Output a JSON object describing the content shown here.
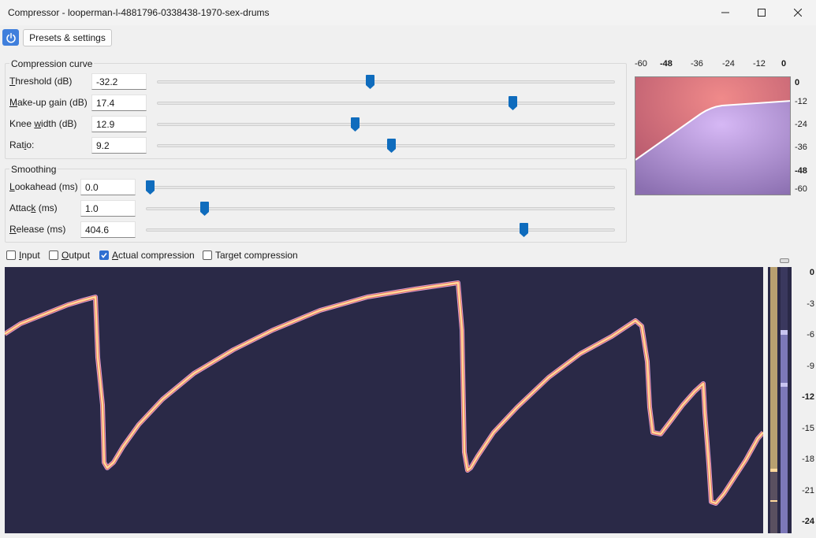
{
  "window": {
    "title": "Compressor - looperman-l-4881796-0338438-1970-sex-drums"
  },
  "toolbar": {
    "power_icon": "power-icon",
    "presets_label": "Presets & settings"
  },
  "compression_curve": {
    "title": "Compression curve",
    "rows": [
      {
        "label_pre": "",
        "label_u": "T",
        "label_post": "hreshold (dB)",
        "value": "-32.2",
        "position": 0.465
      },
      {
        "label_pre": "",
        "label_u": "M",
        "label_post": "ake-up gain (dB)",
        "value": "17.4",
        "position": 0.783
      },
      {
        "label_pre": "Knee ",
        "label_u": "w",
        "label_post": "idth (dB)",
        "value": "12.9",
        "position": 0.431
      },
      {
        "label_pre": "Rat",
        "label_u": "i",
        "label_post": "o:",
        "value": "9.2",
        "position": 0.513
      }
    ]
  },
  "smoothing": {
    "title": "Smoothing",
    "rows": [
      {
        "label_pre": "",
        "label_u": "L",
        "label_post": "ookahead (ms)",
        "value": "0.0",
        "position": 0.0
      },
      {
        "label_pre": "Attac",
        "label_u": "k",
        "label_post": " (ms)",
        "value": "1.0",
        "position": 0.118
      },
      {
        "label_pre": "",
        "label_u": "R",
        "label_post": "elease (ms)",
        "value": "404.6",
        "position": 0.812
      }
    ]
  },
  "curve_graph": {
    "x_ticks": [
      "-60",
      "-48",
      "-36",
      "-24",
      "-12",
      "0"
    ],
    "y_ticks": [
      "0",
      "-12",
      "-24",
      "-36",
      "-48",
      "-60"
    ]
  },
  "checkboxes": [
    {
      "label_pre": "",
      "label_u": "I",
      "label_post": "nput",
      "checked": false
    },
    {
      "label_pre": "",
      "label_u": "O",
      "label_post": "utput",
      "checked": false
    },
    {
      "label_pre": "",
      "label_u": "A",
      "label_post": "ctual compression",
      "checked": true
    },
    {
      "label_pre": "",
      "label_u": "",
      "label_post": "Target compression",
      "checked": false
    }
  ],
  "meter_scale": [
    "0",
    "-3",
    "-6",
    "-9",
    "-12",
    "-15",
    "-18",
    "-21",
    "-24"
  ],
  "colors": {
    "plot_bg": "#2a2947",
    "accent": "#0f6cbd",
    "curve_line": "#ffd89b"
  }
}
